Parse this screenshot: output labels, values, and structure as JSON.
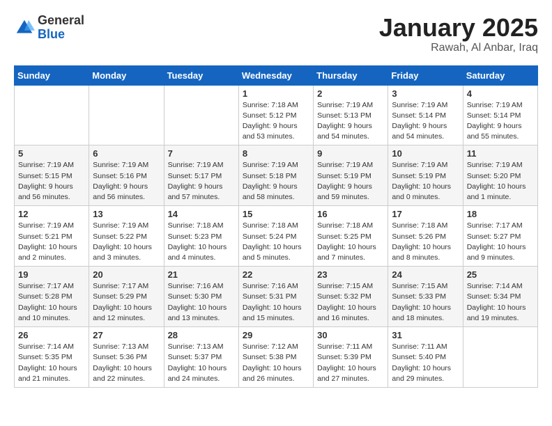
{
  "logo": {
    "general": "General",
    "blue": "Blue"
  },
  "title": "January 2025",
  "subtitle": "Rawah, Al Anbar, Iraq",
  "days_of_week": [
    "Sunday",
    "Monday",
    "Tuesday",
    "Wednesday",
    "Thursday",
    "Friday",
    "Saturday"
  ],
  "weeks": [
    [
      {
        "day": "",
        "detail": ""
      },
      {
        "day": "",
        "detail": ""
      },
      {
        "day": "",
        "detail": ""
      },
      {
        "day": "1",
        "detail": "Sunrise: 7:18 AM\nSunset: 5:12 PM\nDaylight: 9 hours\nand 53 minutes."
      },
      {
        "day": "2",
        "detail": "Sunrise: 7:19 AM\nSunset: 5:13 PM\nDaylight: 9 hours\nand 54 minutes."
      },
      {
        "day": "3",
        "detail": "Sunrise: 7:19 AM\nSunset: 5:14 PM\nDaylight: 9 hours\nand 54 minutes."
      },
      {
        "day": "4",
        "detail": "Sunrise: 7:19 AM\nSunset: 5:14 PM\nDaylight: 9 hours\nand 55 minutes."
      }
    ],
    [
      {
        "day": "5",
        "detail": "Sunrise: 7:19 AM\nSunset: 5:15 PM\nDaylight: 9 hours\nand 56 minutes."
      },
      {
        "day": "6",
        "detail": "Sunrise: 7:19 AM\nSunset: 5:16 PM\nDaylight: 9 hours\nand 56 minutes."
      },
      {
        "day": "7",
        "detail": "Sunrise: 7:19 AM\nSunset: 5:17 PM\nDaylight: 9 hours\nand 57 minutes."
      },
      {
        "day": "8",
        "detail": "Sunrise: 7:19 AM\nSunset: 5:18 PM\nDaylight: 9 hours\nand 58 minutes."
      },
      {
        "day": "9",
        "detail": "Sunrise: 7:19 AM\nSunset: 5:19 PM\nDaylight: 9 hours\nand 59 minutes."
      },
      {
        "day": "10",
        "detail": "Sunrise: 7:19 AM\nSunset: 5:19 PM\nDaylight: 10 hours\nand 0 minutes."
      },
      {
        "day": "11",
        "detail": "Sunrise: 7:19 AM\nSunset: 5:20 PM\nDaylight: 10 hours\nand 1 minute."
      }
    ],
    [
      {
        "day": "12",
        "detail": "Sunrise: 7:19 AM\nSunset: 5:21 PM\nDaylight: 10 hours\nand 2 minutes."
      },
      {
        "day": "13",
        "detail": "Sunrise: 7:19 AM\nSunset: 5:22 PM\nDaylight: 10 hours\nand 3 minutes."
      },
      {
        "day": "14",
        "detail": "Sunrise: 7:18 AM\nSunset: 5:23 PM\nDaylight: 10 hours\nand 4 minutes."
      },
      {
        "day": "15",
        "detail": "Sunrise: 7:18 AM\nSunset: 5:24 PM\nDaylight: 10 hours\nand 5 minutes."
      },
      {
        "day": "16",
        "detail": "Sunrise: 7:18 AM\nSunset: 5:25 PM\nDaylight: 10 hours\nand 7 minutes."
      },
      {
        "day": "17",
        "detail": "Sunrise: 7:18 AM\nSunset: 5:26 PM\nDaylight: 10 hours\nand 8 minutes."
      },
      {
        "day": "18",
        "detail": "Sunrise: 7:17 AM\nSunset: 5:27 PM\nDaylight: 10 hours\nand 9 minutes."
      }
    ],
    [
      {
        "day": "19",
        "detail": "Sunrise: 7:17 AM\nSunset: 5:28 PM\nDaylight: 10 hours\nand 10 minutes."
      },
      {
        "day": "20",
        "detail": "Sunrise: 7:17 AM\nSunset: 5:29 PM\nDaylight: 10 hours\nand 12 minutes."
      },
      {
        "day": "21",
        "detail": "Sunrise: 7:16 AM\nSunset: 5:30 PM\nDaylight: 10 hours\nand 13 minutes."
      },
      {
        "day": "22",
        "detail": "Sunrise: 7:16 AM\nSunset: 5:31 PM\nDaylight: 10 hours\nand 15 minutes."
      },
      {
        "day": "23",
        "detail": "Sunrise: 7:15 AM\nSunset: 5:32 PM\nDaylight: 10 hours\nand 16 minutes."
      },
      {
        "day": "24",
        "detail": "Sunrise: 7:15 AM\nSunset: 5:33 PM\nDaylight: 10 hours\nand 18 minutes."
      },
      {
        "day": "25",
        "detail": "Sunrise: 7:14 AM\nSunset: 5:34 PM\nDaylight: 10 hours\nand 19 minutes."
      }
    ],
    [
      {
        "day": "26",
        "detail": "Sunrise: 7:14 AM\nSunset: 5:35 PM\nDaylight: 10 hours\nand 21 minutes."
      },
      {
        "day": "27",
        "detail": "Sunrise: 7:13 AM\nSunset: 5:36 PM\nDaylight: 10 hours\nand 22 minutes."
      },
      {
        "day": "28",
        "detail": "Sunrise: 7:13 AM\nSunset: 5:37 PM\nDaylight: 10 hours\nand 24 minutes."
      },
      {
        "day": "29",
        "detail": "Sunrise: 7:12 AM\nSunset: 5:38 PM\nDaylight: 10 hours\nand 26 minutes."
      },
      {
        "day": "30",
        "detail": "Sunrise: 7:11 AM\nSunset: 5:39 PM\nDaylight: 10 hours\nand 27 minutes."
      },
      {
        "day": "31",
        "detail": "Sunrise: 7:11 AM\nSunset: 5:40 PM\nDaylight: 10 hours\nand 29 minutes."
      },
      {
        "day": "",
        "detail": ""
      }
    ]
  ]
}
